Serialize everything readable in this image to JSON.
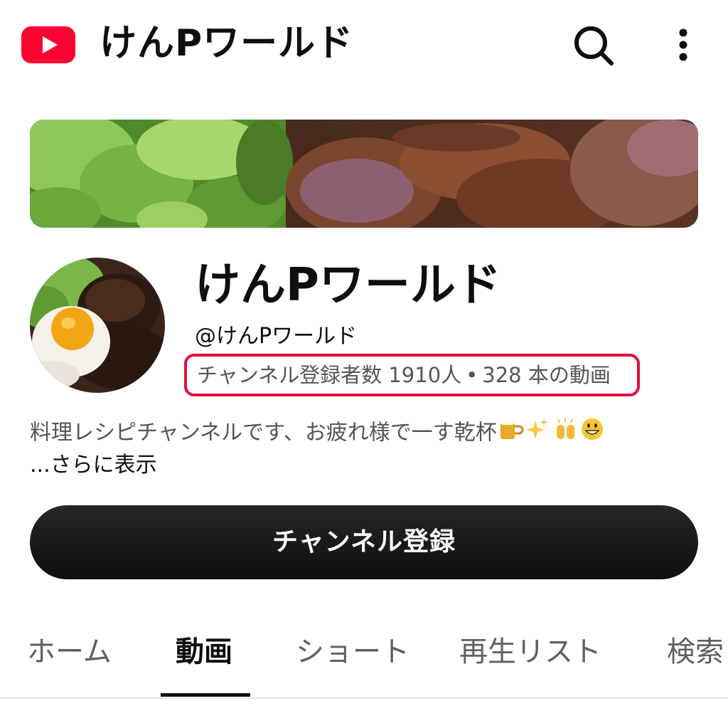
{
  "header": {
    "app_title": "けんPワールド",
    "logo_icon": "youtube-logo-icon",
    "search_icon": "search-icon",
    "more_icon": "more-vertical-icon"
  },
  "channel": {
    "banner_image": "food-photo-lettuce-and-grilled-meat",
    "avatar_image": "hamburg-steak-with-fried-egg",
    "name": "けんPワールド",
    "handle": "@けんPワールド",
    "subscribers": "チャンネル登録者数 1910人",
    "separator": "•",
    "videos": "328 本の動画",
    "description": "料理レシピチャンネルです、お疲れ様で一す乾杯",
    "description_emojis": [
      "beer-mug-icon",
      "sparkles-icon",
      "raised-hands-icon",
      "grinning-face-icon"
    ],
    "more_label": "...さらに表示",
    "highlight_color": "#e0103f"
  },
  "subscribe": {
    "label": "チャンネル登録"
  },
  "tabs": [
    {
      "label": "ホーム",
      "active": false
    },
    {
      "label": "動画",
      "active": true
    },
    {
      "label": "ショート",
      "active": false
    },
    {
      "label": "再生リスト",
      "active": false
    },
    {
      "label": "検索",
      "active": false
    }
  ],
  "colors": {
    "brand_red": "#ff0000",
    "text_primary": "#0f0f0f",
    "text_secondary": "#606060"
  }
}
